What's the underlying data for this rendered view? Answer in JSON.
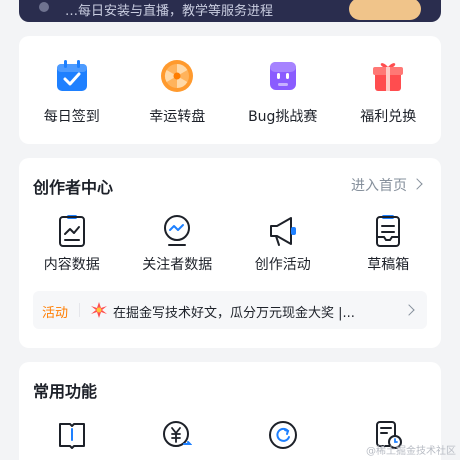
{
  "banner": {
    "text": "…每日安装与直播，教学等服务进程"
  },
  "quick_actions": [
    {
      "label": "每日签到",
      "icon": "calendar-check-icon"
    },
    {
      "label": "幸运转盘",
      "icon": "lucky-wheel-icon"
    },
    {
      "label": "Bug挑战赛",
      "icon": "bug-robot-icon"
    },
    {
      "label": "福利兑换",
      "icon": "gift-box-icon"
    }
  ],
  "creator_center": {
    "title": "创作者中心",
    "enter_link": "进入首页",
    "items": [
      {
        "label": "内容数据",
        "icon": "content-data-icon"
      },
      {
        "label": "关注者数据",
        "icon": "follower-data-icon"
      },
      {
        "label": "创作活动",
        "icon": "megaphone-icon"
      },
      {
        "label": "草稿箱",
        "icon": "drafts-icon"
      }
    ],
    "activity": {
      "tag": "活动",
      "text": "在掘金写技术好文，瓜分万元现金大奖 |..."
    }
  },
  "common_functions": {
    "title": "常用功能",
    "items": [
      {
        "icon": "book-icon"
      },
      {
        "icon": "yuan-exchange-icon"
      },
      {
        "icon": "refresh-circle-icon"
      },
      {
        "icon": "document-clock-icon"
      }
    ]
  },
  "watermark": "@稀土掘金技术社区",
  "colors": {
    "page_bg": "#f3f4f6",
    "card_bg": "#ffffff",
    "accent_orange": "#ff7d00",
    "muted_text": "#86909c",
    "checkin_blue": "#1e80ff",
    "wheel_orange": "#ff9a2e",
    "bug_purple": "#8a5cff",
    "gift_red": "#ff4d4f"
  }
}
